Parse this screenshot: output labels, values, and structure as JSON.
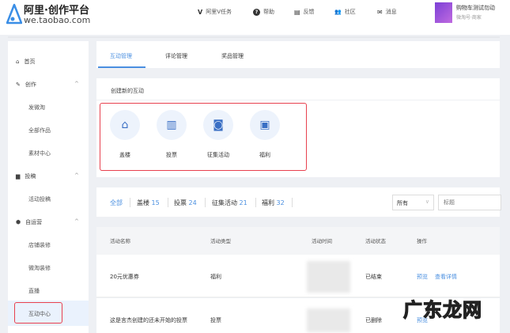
{
  "header": {
    "logo_title": "阿里·创作平台",
    "logo_domain": "we.taobao.com",
    "nav": [
      {
        "icon": "v-icon",
        "glyph": "V",
        "label": "阿里V任务"
      },
      {
        "icon": "help-icon",
        "glyph": "?",
        "label": "帮助"
      },
      {
        "icon": "feedback-icon",
        "glyph": "▤",
        "label": "反馈"
      },
      {
        "icon": "community-icon",
        "glyph": "👥",
        "label": "社区"
      },
      {
        "icon": "message-icon",
        "glyph": "✉",
        "label": "消息"
      }
    ],
    "user": {
      "name": "购物车测试勿动",
      "sub": "微淘号·商家"
    }
  },
  "sidebar": {
    "items": [
      {
        "label": "首页",
        "icon": "home-icon"
      },
      {
        "label": "创作",
        "icon": "pen-icon"
      },
      {
        "label": "发微淘"
      },
      {
        "label": "全部作品"
      },
      {
        "label": "素材中心"
      },
      {
        "label": "投稿",
        "icon": "document-icon"
      },
      {
        "label": "活动投稿"
      },
      {
        "label": "自运营",
        "icon": "box-icon"
      },
      {
        "label": "店铺装修"
      },
      {
        "label": "微淘装修"
      },
      {
        "label": "直播"
      },
      {
        "label": "互动中心"
      }
    ]
  },
  "tabs": [
    "互动管理",
    "评论管理",
    "奖品管理"
  ],
  "create": {
    "title": "创建新的互动",
    "items": [
      "盖楼",
      "投票",
      "征集活动",
      "福利"
    ]
  },
  "filters": {
    "all": "全部",
    "items": [
      {
        "label": "盖楼",
        "count": "15"
      },
      {
        "label": "投票",
        "count": "24"
      },
      {
        "label": "征集活动",
        "count": "21"
      },
      {
        "label": "福利",
        "count": "32"
      }
    ],
    "select": "所有",
    "search_placeholder": "标题"
  },
  "table": {
    "headers": [
      "活动名称",
      "活动类型",
      "活动时间",
      "活动状态",
      "操作"
    ],
    "rows": [
      {
        "name": "20元优惠券",
        "type": "福利",
        "status": "已结束",
        "actions": [
          "预览",
          "查看详情"
        ]
      },
      {
        "name": "这是言杰创建的还未开始的投票",
        "type": "投票",
        "status": "已删除",
        "actions": [
          "预览"
        ]
      }
    ]
  },
  "watermark": "广东龙网",
  "colors": {
    "accent": "#4a8fe0",
    "highlight": "#e8414f"
  }
}
